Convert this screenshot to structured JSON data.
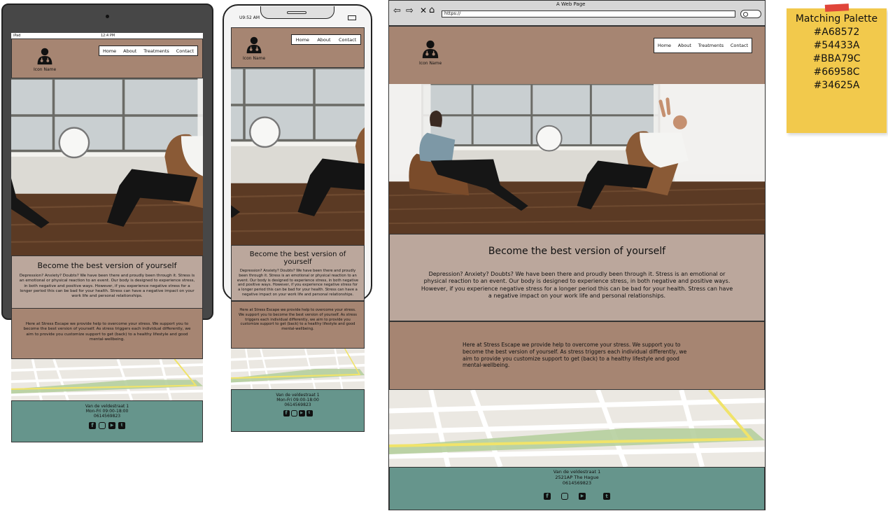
{
  "palette": {
    "title": "Matching Palette",
    "colors": [
      "#A68572",
      "#54433A",
      "#BBA79C",
      "#66958C",
      "#34625A"
    ]
  },
  "browser": {
    "title": "A Web Page",
    "url": "https://"
  },
  "tablet": {
    "status_left": "iPad",
    "status_time": "12:4 PM"
  },
  "phone": {
    "status_time": "U9:52 AM"
  },
  "site": {
    "logo_name": "Icon Name",
    "nav": [
      "Home",
      "About",
      "Treatments",
      "Contact"
    ],
    "hero_title": "Become the best version of yourself",
    "intro": "Depression? Anxiety? Doubts? We have been there and proudly been through it. Stress is an emotional or physical reaction to an event. Our body is designed to experience stress, in both negative and positive ways. However, if you experience negative stress for a longer period this can be bad for your health. Stress can have a negative impact on your work life and personal relationships.",
    "support": "Here at Stress Escape we provide help to overcome your stress. We support you to become the best version of yourself. As stress triggers each individual differently, we aim to provide you customize support to get (back) to a healthy lifestyle and good mental-wellbeing.",
    "footer": {
      "address": "Van de veldestraat 1",
      "postcode": "2521AP The Hague",
      "hours": "Mon-Fri 09:00-18:00",
      "phone": "0614569823"
    },
    "social_icons": [
      "facebook-icon",
      "instagram-icon",
      "youtube-icon",
      "twitter-icon"
    ]
  }
}
